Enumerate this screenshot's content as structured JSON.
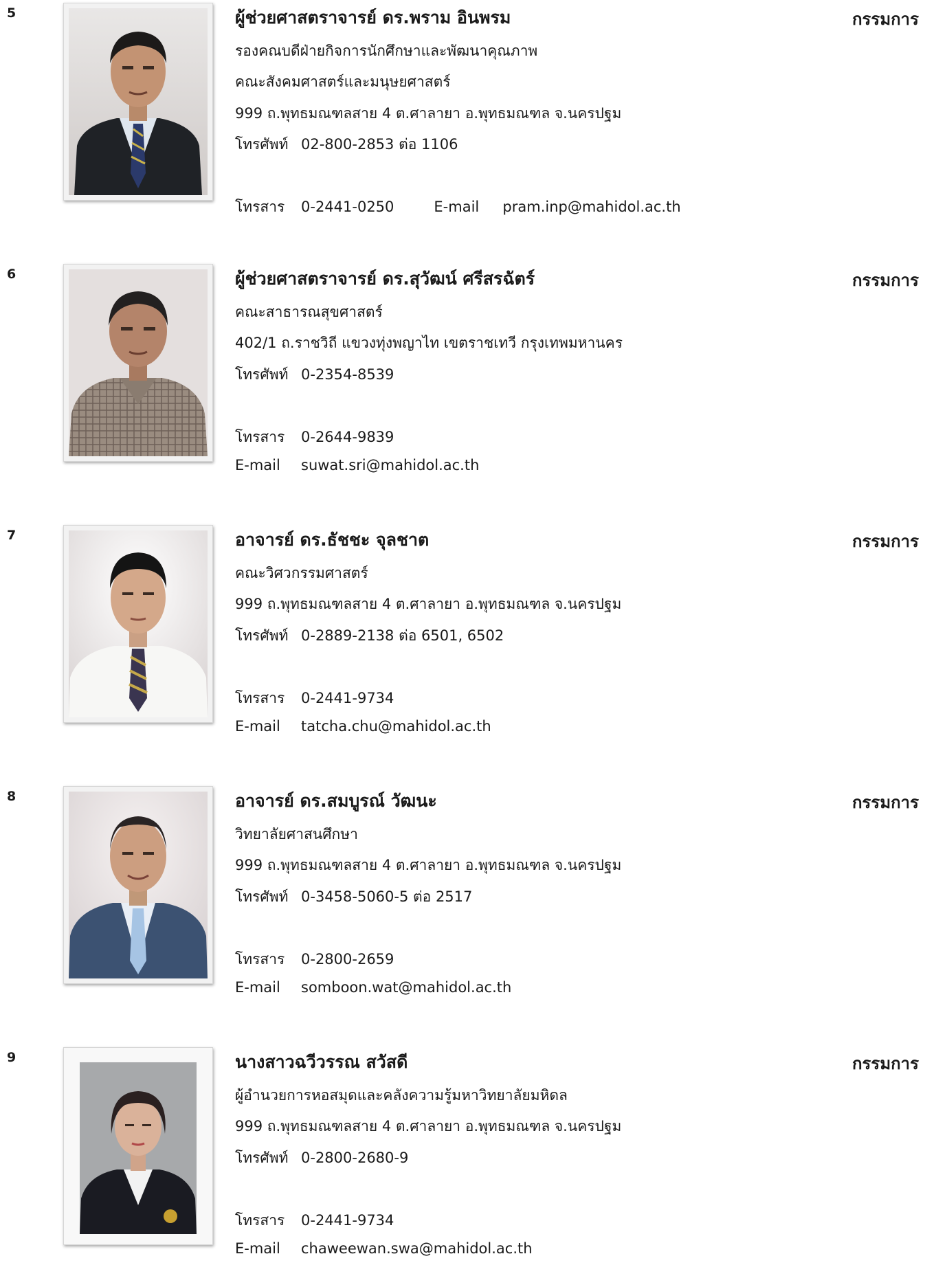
{
  "entries": [
    {
      "number": "5",
      "name": "ผู้ช่วยศาสตราจารย์ ดร.พราม อินพรม",
      "role": "กรรมการ",
      "lines": [
        "รองคณบดีฝ่ายกิจการนักศึกษาและพัฒนาคุณภาพ",
        "คณะสังคมศาสตร์และมนุษยศาสตร์",
        "999 ถ.พุทธมณฑลสาย 4 ต.ศาลายา อ.พุทธมณฑล จ.นครปฐม"
      ],
      "phone_label": "โทรศัพท์",
      "phone": "02-800-2853 ต่อ 1106",
      "fax_label": "โทรสาร",
      "fax": "0-2441-0250",
      "email_label": "E-mail",
      "email": "pram.inp@mahidol.ac.th"
    },
    {
      "number": "6",
      "name": "ผู้ช่วยศาสตราจารย์ ดร.สุวัฒน์ ศรีสรฉัตร์",
      "role": "กรรมการ",
      "lines": [
        "คณะสาธารณสุขศาสตร์",
        "402/1 ถ.ราชวิถี แขวงทุ่งพญาไท  เขตราชเทวี กรุงเทพมหานคร"
      ],
      "phone_label": "โทรศัพท์",
      "phone": "0-2354-8539",
      "fax_label": "โทรสาร",
      "fax": "0-2644-9839",
      "email_label": "E-mail",
      "email": "suwat.sri@mahidol.ac.th"
    },
    {
      "number": "7",
      "name": "อาจารย์ ดร.ธัชชะ จุลชาต",
      "role": "กรรมการ",
      "lines": [
        "คณะวิศวกรรมศาสตร์",
        "999 ถ.พุทธมณฑลสาย 4 ต.ศาลายา อ.พุทธมณฑล จ.นครปฐม"
      ],
      "phone_label": "โทรศัพท์",
      "phone": "0-2889-2138 ต่อ 6501, 6502",
      "fax_label": "โทรสาร",
      "fax": "0-2441-9734",
      "email_label": "E-mail",
      "email": "tatcha.chu@mahidol.ac.th"
    },
    {
      "number": "8",
      "name": "อาจารย์ ดร.สมบูรณ์ วัฒนะ",
      "role": "กรรมการ",
      "lines": [
        "วิทยาลัยศาสนศึกษา",
        "999 ถ.พุทธมณฑลสาย 4 ต.ศาลายา อ.พุทธมณฑล จ.นครปฐม"
      ],
      "phone_label": "โทรศัพท์",
      "phone": "0-3458-5060-5 ต่อ 2517",
      "fax_label": "โทรสาร",
      "fax": "0-2800-2659",
      "email_label": "E-mail",
      "email": "somboon.wat@mahidol.ac.th"
    },
    {
      "number": "9",
      "name": "นางสาวฉวีวรรณ  สวัสดี",
      "role": "กรรมการ",
      "lines": [
        "ผู้อำนวยการหอสมุดและคลังความรู้มหาวิทยาลัยมหิดล",
        "999 ถ.พุทธมณฑลสาย 4 ต.ศาลายา อ.พุทธมณฑล จ.นครปฐม"
      ],
      "phone_label": "โทรศัพท์",
      "phone": "0-2800-2680-9",
      "fax_label": "โทรสาร",
      "fax": "0-2441-9734",
      "email_label": "E-mail",
      "email": "chaweewan.swa@mahidol.ac.th"
    }
  ]
}
